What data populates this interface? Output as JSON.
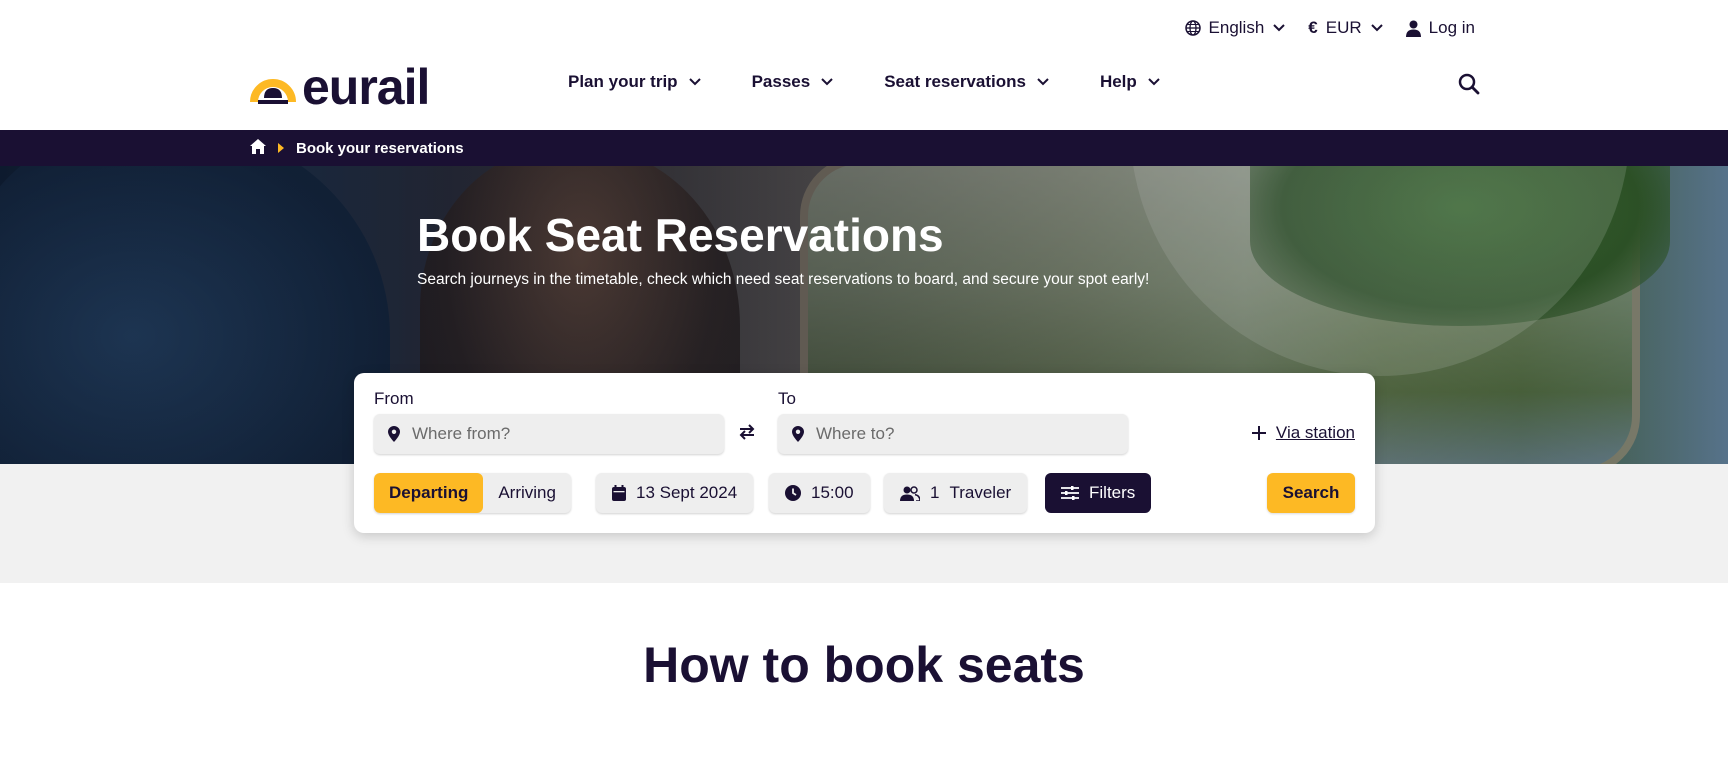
{
  "utility": {
    "language": "English",
    "currency_symbol": "€",
    "currency": "EUR",
    "login": "Log in"
  },
  "logo": {
    "text": "eurail"
  },
  "nav": {
    "items": [
      {
        "label": "Plan your trip"
      },
      {
        "label": "Passes"
      },
      {
        "label": "Seat reservations"
      },
      {
        "label": "Help"
      }
    ]
  },
  "breadcrumb": {
    "current": "Book your reservations"
  },
  "hero": {
    "title": "Book Seat Reservations",
    "subtitle": "Search journeys in the timetable, check which need seat reservations to board, and secure your spot early!"
  },
  "search": {
    "from_label": "From",
    "from_placeholder": "Where from?",
    "to_label": "To",
    "to_placeholder": "Where to?",
    "via_label": "Via station",
    "departing": "Departing",
    "arriving": "Arriving",
    "date": "13 Sept 2024",
    "time": "15:00",
    "traveler_count": "1",
    "traveler_label": "Traveler",
    "filters": "Filters",
    "search_button": "Search"
  },
  "section": {
    "how_title": "How to book seats"
  },
  "colors": {
    "brand_navy": "#1a1033",
    "brand_yellow": "#fdb924",
    "field_bg": "#eeeeee",
    "band_grey": "#f1f1f1"
  },
  "icons": [
    "globe-icon",
    "chevron-down-icon",
    "user-icon",
    "search-icon",
    "home-icon",
    "chevron-right-icon",
    "location-pin-icon",
    "swap-icon",
    "plus-icon",
    "calendar-icon",
    "clock-icon",
    "users-icon",
    "sliders-icon"
  ]
}
